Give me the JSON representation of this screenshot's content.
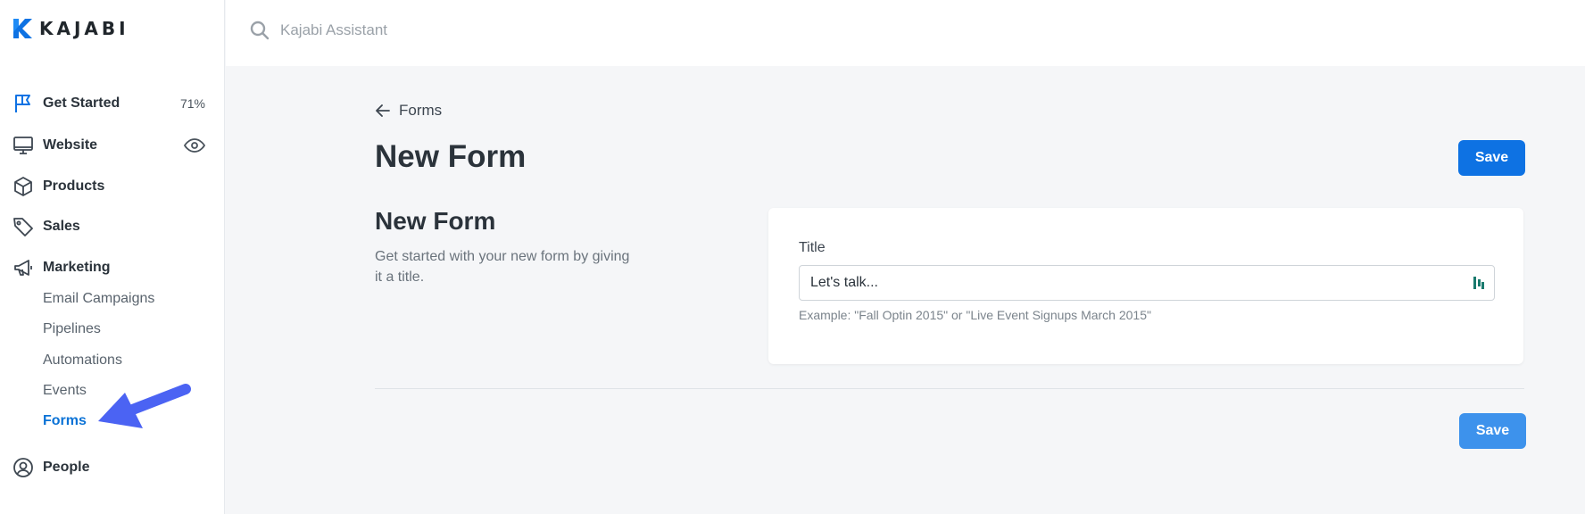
{
  "brand": {
    "name": "KAJABI",
    "color": "#0e72e3"
  },
  "search": {
    "placeholder": "Kajabi Assistant"
  },
  "sidebar": {
    "items": [
      {
        "label": "Get Started",
        "icon": "flag-icon",
        "badge": "71%"
      },
      {
        "label": "Website",
        "icon": "monitor-icon",
        "right_icon": "eye-icon"
      },
      {
        "label": "Products",
        "icon": "box-icon"
      },
      {
        "label": "Sales",
        "icon": "tag-icon"
      },
      {
        "label": "Marketing",
        "icon": "megaphone-icon"
      },
      {
        "label": "People",
        "icon": "user-circle-icon"
      }
    ],
    "marketing_subitems": [
      "Email Campaigns",
      "Pipelines",
      "Automations",
      "Events",
      "Forms"
    ],
    "active_subitem": "Forms"
  },
  "breadcrumb": {
    "back_label": "Forms"
  },
  "page": {
    "title": "New Form",
    "save_label": "Save",
    "section_title": "New Form",
    "section_desc": "Get started with your new form by giving it a title."
  },
  "form": {
    "title_label": "Title",
    "title_placeholder": "Let's talk...",
    "title_hint": "Example: \"Fall Optin 2015\" or \"Live Event Signups March 2015\""
  },
  "colors": {
    "accent": "#0e72e3",
    "active_nav": "#0a72d6",
    "annotation_arrow": "#4b63f3"
  }
}
